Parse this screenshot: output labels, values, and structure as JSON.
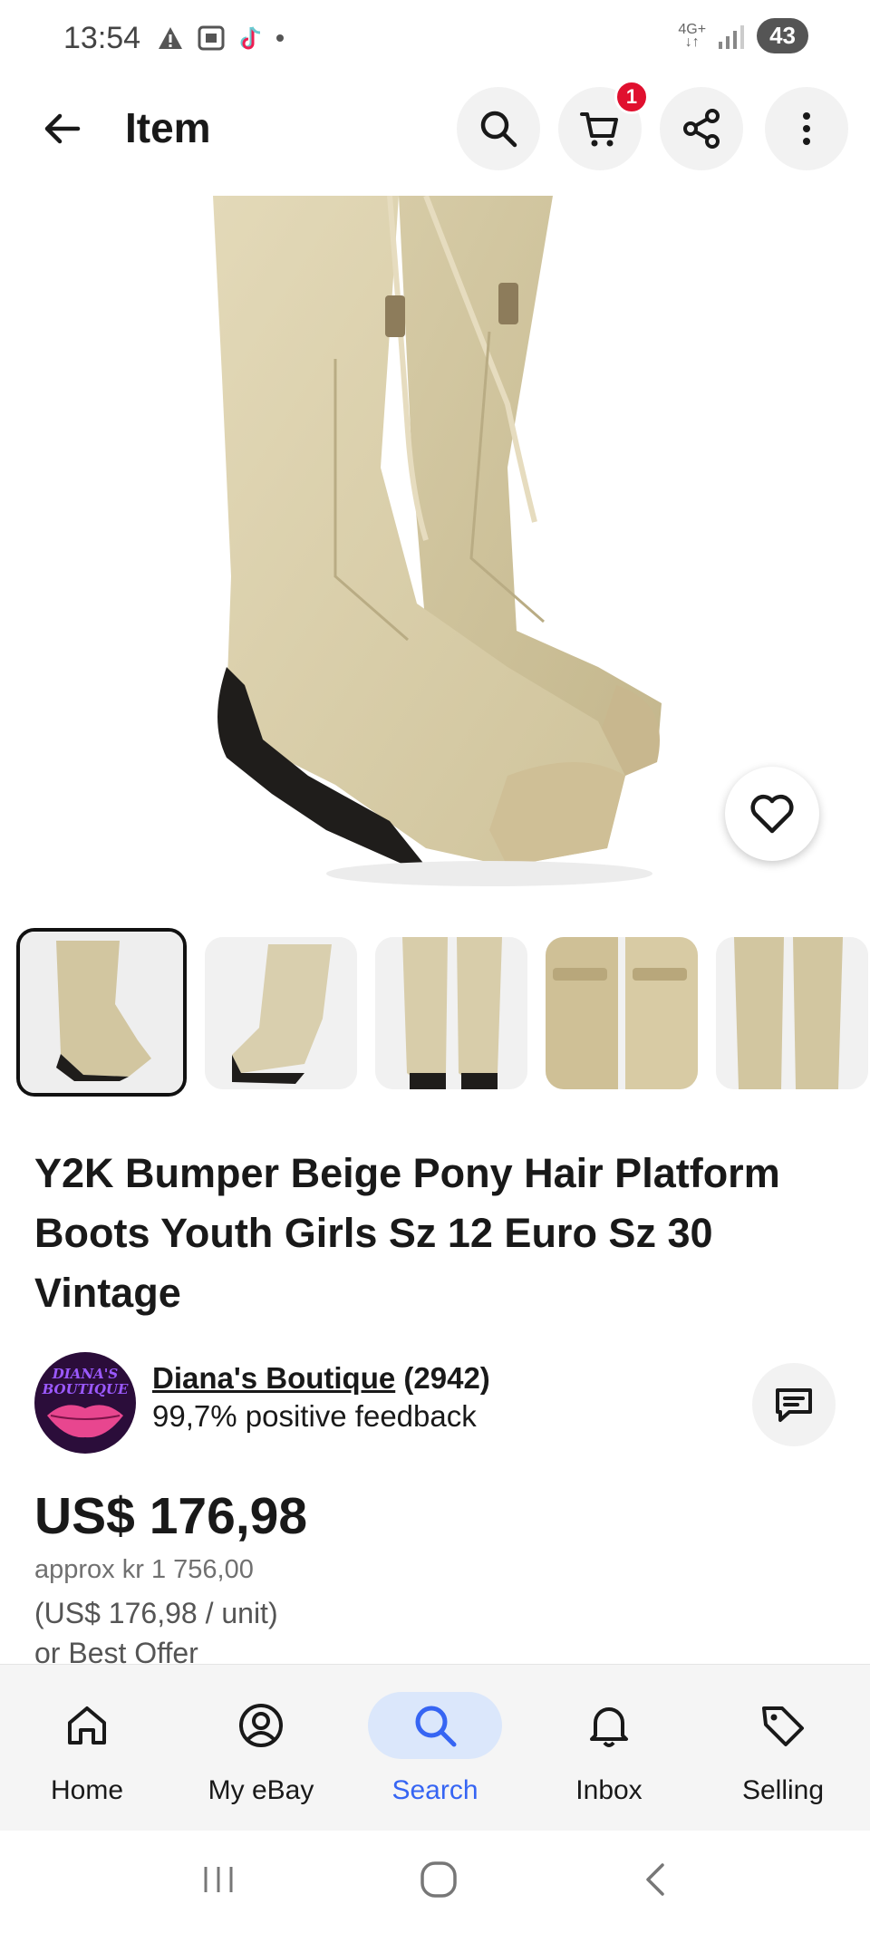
{
  "status_bar": {
    "time": "13:54",
    "network": "4G+",
    "battery": "43"
  },
  "header": {
    "title": "Item",
    "cart_badge": "1"
  },
  "listing": {
    "title": "Y2K Bumper Beige Pony Hair Platform Boots Youth Girls Sz 12 Euro Sz 30 Vintage",
    "image_count_thumbs": 5
  },
  "seller": {
    "avatar_text": "DIANA'S BOUTIQUE",
    "name": "Diana's Boutique",
    "count": "(2942)",
    "feedback": "99,7% positive feedback"
  },
  "price": {
    "main": "US$ 176,98",
    "approx": "approx kr 1 756,00",
    "unit": "(US$ 176,98 / unit)",
    "offer": "or Best Offer"
  },
  "bottom_nav": {
    "home": "Home",
    "myebay": "My eBay",
    "search": "Search",
    "inbox": "Inbox",
    "selling": "Selling",
    "active": "search"
  },
  "colors": {
    "accent": "#3665f3",
    "active_pill": "#dbe7fb",
    "badge": "#e0102f",
    "text": "#191919"
  }
}
